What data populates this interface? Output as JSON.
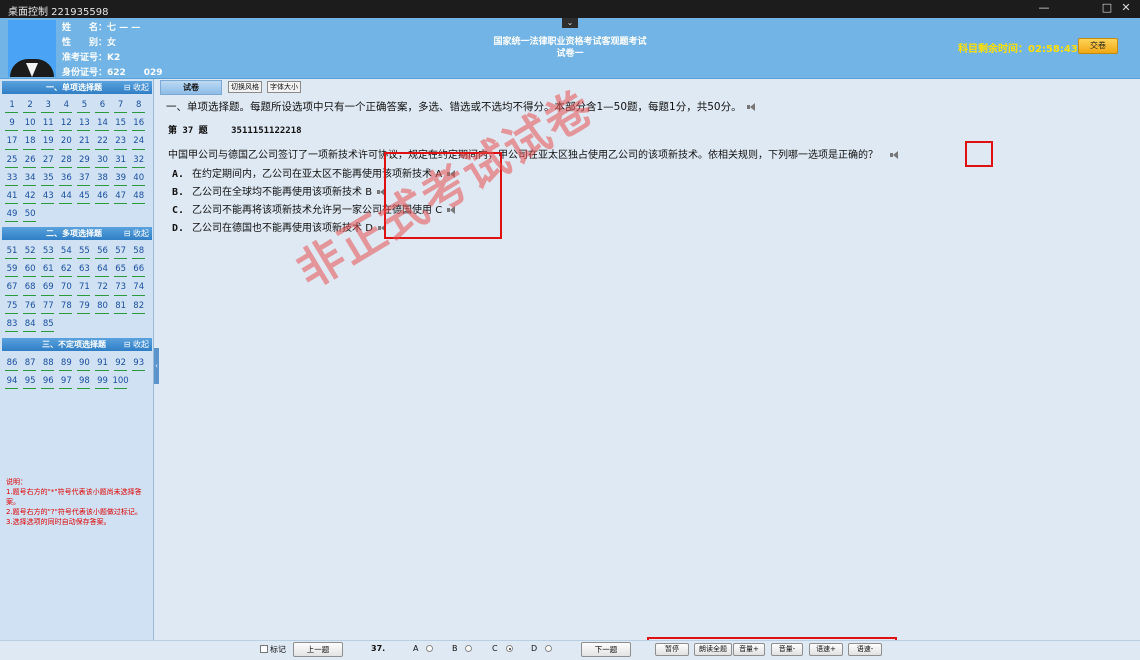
{
  "window": {
    "title": "桌面控制 221935598",
    "controls": [
      "—",
      "□",
      "✕"
    ]
  },
  "candidate": {
    "name_label": "姓　　名：",
    "name_value": "七 — —",
    "gender_label": "性　　别：",
    "gender_value": "女",
    "ticket_label": "准考证号：",
    "ticket_value": "K2             ",
    "id_label": "身份证号：",
    "id_value": "622          029"
  },
  "exam": {
    "title_line1": "国家统一法律职业资格考试客观题考试",
    "title_line2": "试卷一"
  },
  "timer": {
    "label": "科目剩余时间：",
    "value": "02:58:43"
  },
  "submit_label": "交卷",
  "sidebar": {
    "collapse_label": "⊟ 收起",
    "sections": [
      {
        "title": "一、单项选择题",
        "numbers": [
          "1",
          "2",
          "3",
          "4",
          "5",
          "6",
          "7",
          "8",
          "9",
          "10",
          "11",
          "12",
          "13",
          "14",
          "15",
          "16",
          "17",
          "18",
          "19",
          "20",
          "21",
          "22",
          "23",
          "24",
          "25",
          "26",
          "27",
          "28",
          "29",
          "30",
          "31",
          "32",
          "33",
          "34",
          "35",
          "36",
          "37",
          "38",
          "39",
          "40",
          "41",
          "42",
          "43",
          "44",
          "45",
          "46",
          "47",
          "48",
          "49",
          "50"
        ]
      },
      {
        "title": "二、多项选择题",
        "numbers": [
          "51",
          "52",
          "53",
          "54",
          "55",
          "56",
          "57",
          "58",
          "59",
          "60",
          "61",
          "62",
          "63",
          "64",
          "65",
          "66",
          "67",
          "68",
          "69",
          "70",
          "71",
          "72",
          "73",
          "74",
          "75",
          "76",
          "77",
          "78",
          "79",
          "80",
          "81",
          "82",
          "83",
          "84",
          "85"
        ]
      },
      {
        "title": "三、不定项选择题",
        "numbers": [
          "86",
          "87",
          "88",
          "89",
          "90",
          "91",
          "92",
          "93",
          "94",
          "95",
          "96",
          "97",
          "98",
          "99",
          "100"
        ]
      }
    ],
    "notes": [
      "说明：",
      "1.题号右方的\"*\"符号代表该小题尚未选择答案。",
      "2.题号右方的\"?\"符号代表该小题做过标记。",
      "3.选择选项的同时自动保存答案。"
    ]
  },
  "tabs": {
    "paper": "试卷",
    "switch_style": "切换风格",
    "font_size": "字体大小"
  },
  "section_instruction": "一、单项选择题。每题所设选项中只有一个正确答案，多选、错选或不选均不得分。本部分含1—50题，每题1分，共50分。",
  "question": {
    "number_label": "第 37 题",
    "code": "3511151122218",
    "stem": "中国甲公司与德国乙公司签订了一项新技术许可协议，规定在约定期间内，甲公司在亚太区独占使用乙公司的该项新技术。依相关规则，下列哪一选项是正确的？",
    "options": [
      {
        "letter": "A.",
        "text": "在约定期间内，乙公司在亚太区不能再使用该项新技术 A"
      },
      {
        "letter": "B.",
        "text": "乙公司在全球均不能再使用该项新技术 B"
      },
      {
        "letter": "C.",
        "text": "乙公司不能再将该项新技术允许另一家公司在德国使用 C"
      },
      {
        "letter": "D.",
        "text": "乙公司在德国也不能再使用该项新技术 D"
      }
    ]
  },
  "watermark": "非正式考试试卷",
  "bottom": {
    "mark_label": "标记",
    "prev_label": "上一题",
    "current_no": "37.",
    "answer_letters": [
      "A",
      "B",
      "C",
      "D"
    ],
    "selected": "C",
    "next_label": "下一题",
    "audio_controls": [
      "暂停",
      "朗读全题",
      "音量+",
      "音量-",
      "语速+",
      "语速-"
    ]
  }
}
